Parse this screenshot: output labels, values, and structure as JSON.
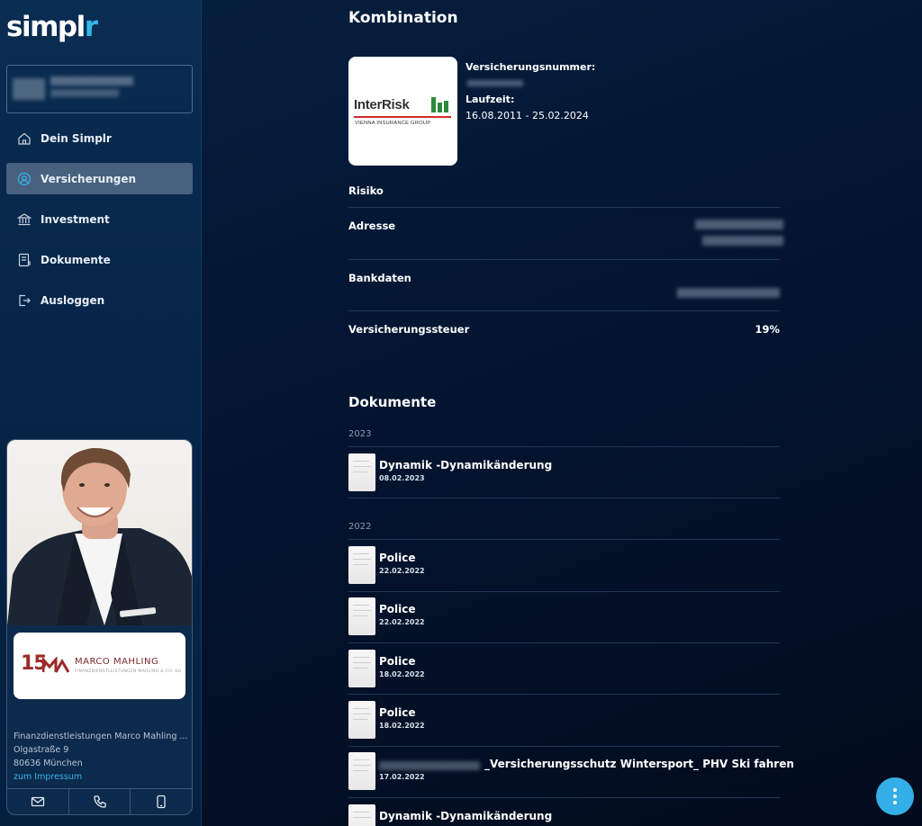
{
  "app": {
    "logo": {
      "main": "simpl",
      "accent": "r"
    }
  },
  "sidebar": {
    "nav": [
      {
        "label": "Dein Simplr",
        "icon": "home-icon",
        "active": false
      },
      {
        "label": "Versicherungen",
        "icon": "umbrella-icon",
        "active": true
      },
      {
        "label": "Investment",
        "icon": "bank-icon",
        "active": false
      },
      {
        "label": "Dokumente",
        "icon": "document-icon",
        "active": false
      },
      {
        "label": "Ausloggen",
        "icon": "logout-icon",
        "active": false
      }
    ],
    "advisor": {
      "brand_number": "15",
      "brand_name": "MARCO MAHLING",
      "brand_sub": "FINANZDIENSTLEISTUNGEN MAHLING & CO. KG",
      "company": "Finanzdienstleistungen Marco Mahling ...",
      "street": "Olgastraße 9",
      "city": "80636 München",
      "impressum_link": "zum Impressum"
    },
    "contact_icons": [
      "mail-icon",
      "phone-icon",
      "mobile-icon"
    ]
  },
  "policy": {
    "title": "Kombination",
    "insurer_logo": {
      "name": "InterRisk",
      "subtitle": "VIENNA INSURANCE GROUP"
    },
    "number_label": "Versicherungsnummer:",
    "term_label": "Laufzeit:",
    "term_value": "16.08.2011 - 25.02.2024",
    "details": [
      {
        "label": "Risiko"
      },
      {
        "label": "Adresse"
      },
      {
        "label": "Bankdaten"
      },
      {
        "label": "Versicherungssteuer",
        "value": "19%"
      }
    ]
  },
  "documents": {
    "title": "Dokumente",
    "groups": [
      {
        "year": "2023",
        "items": [
          {
            "title": "Dynamik -Dynamikänderung",
            "date": "08.02.2023"
          }
        ]
      },
      {
        "year": "2022",
        "items": [
          {
            "title": "Police",
            "date": "22.02.2022"
          },
          {
            "title": "Police",
            "date": "22.02.2022"
          },
          {
            "title": "Police",
            "date": "18.02.2022"
          },
          {
            "title": "Police",
            "date": "18.02.2022"
          },
          {
            "title": "_Versicherungsschutz Wintersport_ PHV Ski fahren",
            "date": "17.02.2022"
          },
          {
            "title": "Dynamik -Dynamikänderung",
            "date": ""
          }
        ]
      }
    ]
  },
  "colors": {
    "accent": "#34b6e8",
    "active_nav": "#48617f",
    "background": "#041633"
  }
}
